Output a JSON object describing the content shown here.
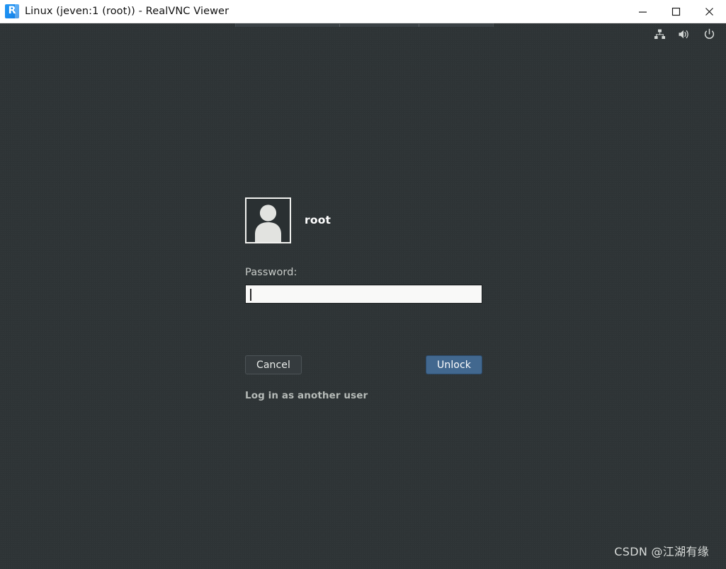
{
  "window": {
    "title": "Linux (jeven:1 (root)) - RealVNC Viewer",
    "app_icon_glyph": "R",
    "controls": {
      "minimize_label": "Minimize",
      "maximize_label": "Maximize",
      "close_label": "Close"
    }
  },
  "tray": {
    "icons": [
      {
        "name": "network-icon",
        "label": "Network"
      },
      {
        "name": "volume-icon",
        "label": "Volume"
      },
      {
        "name": "power-icon",
        "label": "Power"
      }
    ]
  },
  "lock_screen": {
    "user_name": "root",
    "avatar_alt": "User avatar",
    "password_label": "Password:",
    "password_value": "",
    "password_placeholder": "",
    "cancel_label": "Cancel",
    "unlock_label": "Unlock",
    "other_user_link": "Log in as another user"
  },
  "watermark": {
    "text": "CSDN @江湖有缘"
  },
  "colors": {
    "desktop_background": "#2e3436",
    "titlebar_background": "#ffffff",
    "titlebar_text": "#111111",
    "unlock_accent": "#42688f",
    "cancel_background": "#353b3e",
    "input_background": "#f9f9f8",
    "muted_text": "#c8ccc9"
  }
}
